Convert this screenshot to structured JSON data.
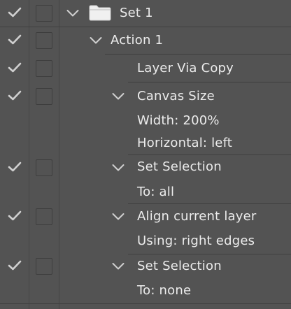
{
  "rows": [
    {
      "label": "Set 1",
      "type": "set"
    },
    {
      "label": "Action 1",
      "type": "action"
    },
    {
      "label": "Layer Via Copy",
      "type": "command"
    },
    {
      "label": "Canvas Size",
      "type": "command"
    },
    {
      "label": "Width: 200%",
      "type": "param"
    },
    {
      "label": "Horizontal: left",
      "type": "param"
    },
    {
      "label": "Set Selection",
      "type": "command"
    },
    {
      "label": "To: all",
      "type": "param"
    },
    {
      "label": "Align current layer",
      "type": "command"
    },
    {
      "label": "Using: right edges",
      "type": "param"
    },
    {
      "label": "Set Selection",
      "type": "command"
    },
    {
      "label": "To: none",
      "type": "param"
    }
  ],
  "icons": {
    "toggle": "checkmark-icon",
    "dialog": "dialog-toggle-box",
    "expand": "chevron-down-icon",
    "set": "folder-icon"
  },
  "colors": {
    "panel_bg": "#535353",
    "divider": "#3f3f3f",
    "text": "#ececec",
    "icon": "#d0d0d0"
  }
}
